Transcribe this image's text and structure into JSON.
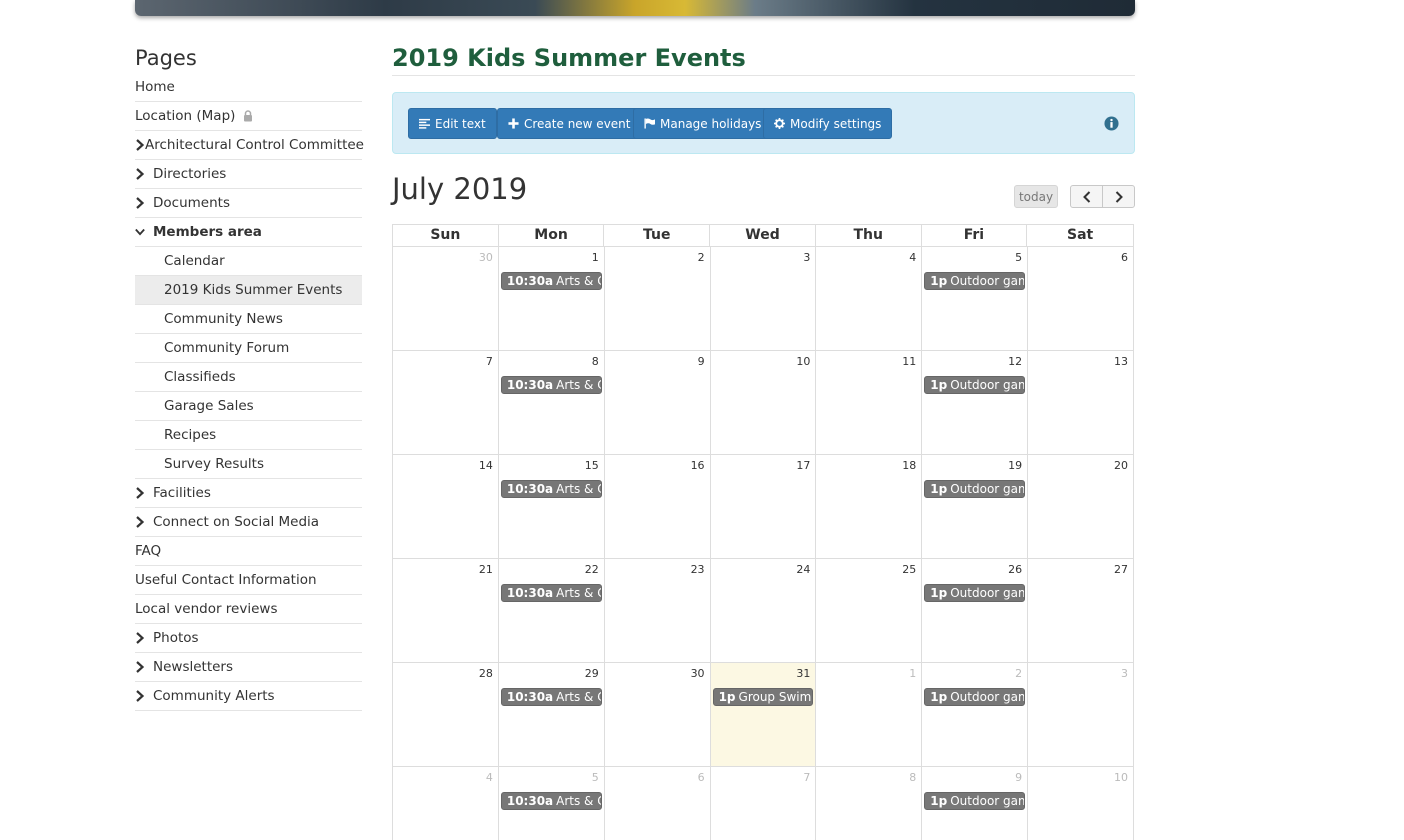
{
  "sidebar": {
    "title": "Pages",
    "items": [
      {
        "label": "Home",
        "type": "plain"
      },
      {
        "label": "Location (Map)",
        "type": "locked"
      },
      {
        "label": "Architectural Control Committee",
        "type": "collapsed"
      },
      {
        "label": "Directories",
        "type": "collapsed"
      },
      {
        "label": "Documents",
        "type": "collapsed"
      },
      {
        "label": "Members area",
        "type": "expanded"
      },
      {
        "label": "Calendar",
        "type": "sub"
      },
      {
        "label": "2019 Kids Summer Events",
        "type": "sub-active"
      },
      {
        "label": "Community News",
        "type": "sub"
      },
      {
        "label": "Community Forum",
        "type": "sub"
      },
      {
        "label": "Classifieds",
        "type": "sub"
      },
      {
        "label": "Garage Sales",
        "type": "sub"
      },
      {
        "label": "Recipes",
        "type": "sub"
      },
      {
        "label": "Survey Results",
        "type": "sub"
      },
      {
        "label": "Facilities",
        "type": "collapsed"
      },
      {
        "label": "Connect on Social Media",
        "type": "collapsed"
      },
      {
        "label": "FAQ",
        "type": "plain"
      },
      {
        "label": "Useful Contact Information",
        "type": "plain"
      },
      {
        "label": "Local vendor reviews",
        "type": "plain"
      },
      {
        "label": "Photos",
        "type": "collapsed"
      },
      {
        "label": "Newsletters",
        "type": "collapsed"
      },
      {
        "label": "Community Alerts",
        "type": "collapsed"
      }
    ]
  },
  "page": {
    "title": "2019 Kids Summer Events"
  },
  "toolbar": {
    "edit_text": "Edit text",
    "create_event": "Create new event",
    "manage_holidays": "Manage holidays",
    "modify_settings": "Modify settings"
  },
  "calendar": {
    "month_title": "July 2019",
    "today_label": "today",
    "weekdays": [
      "Sun",
      "Mon",
      "Tue",
      "Wed",
      "Thu",
      "Fri",
      "Sat"
    ],
    "weeks": [
      [
        {
          "n": "30",
          "o": true
        },
        {
          "n": "1",
          "e": {
            "t": "10:30a",
            "x": "Arts & Crafts"
          }
        },
        {
          "n": "2"
        },
        {
          "n": "3"
        },
        {
          "n": "4"
        },
        {
          "n": "5",
          "e": {
            "t": "1p",
            "x": "Outdoor games"
          }
        },
        {
          "n": "6"
        }
      ],
      [
        {
          "n": "7"
        },
        {
          "n": "8",
          "e": {
            "t": "10:30a",
            "x": "Arts & Crafts"
          }
        },
        {
          "n": "9"
        },
        {
          "n": "10"
        },
        {
          "n": "11"
        },
        {
          "n": "12",
          "e": {
            "t": "1p",
            "x": "Outdoor games"
          }
        },
        {
          "n": "13"
        }
      ],
      [
        {
          "n": "14"
        },
        {
          "n": "15",
          "e": {
            "t": "10:30a",
            "x": "Arts & Crafts"
          }
        },
        {
          "n": "16"
        },
        {
          "n": "17"
        },
        {
          "n": "18"
        },
        {
          "n": "19",
          "e": {
            "t": "1p",
            "x": "Outdoor games"
          }
        },
        {
          "n": "20"
        }
      ],
      [
        {
          "n": "21"
        },
        {
          "n": "22",
          "e": {
            "t": "10:30a",
            "x": "Arts & Crafts"
          }
        },
        {
          "n": "23"
        },
        {
          "n": "24"
        },
        {
          "n": "25"
        },
        {
          "n": "26",
          "e": {
            "t": "1p",
            "x": "Outdoor games"
          }
        },
        {
          "n": "27"
        }
      ],
      [
        {
          "n": "28"
        },
        {
          "n": "29",
          "e": {
            "t": "10:30a",
            "x": "Arts & Crafts"
          }
        },
        {
          "n": "30"
        },
        {
          "n": "31",
          "today": true,
          "e": {
            "t": "1p",
            "x": "Group Swim"
          }
        },
        {
          "n": "1",
          "o": true
        },
        {
          "n": "2",
          "o": true,
          "e": {
            "t": "1p",
            "x": "Outdoor games"
          }
        },
        {
          "n": "3",
          "o": true
        }
      ],
      [
        {
          "n": "4",
          "o": true
        },
        {
          "n": "5",
          "o": true,
          "e": {
            "t": "10:30a",
            "x": "Arts & Crafts"
          }
        },
        {
          "n": "6",
          "o": true
        },
        {
          "n": "7",
          "o": true
        },
        {
          "n": "8",
          "o": true
        },
        {
          "n": "9",
          "o": true,
          "e": {
            "t": "1p",
            "x": "Outdoor games"
          }
        },
        {
          "n": "10",
          "o": true
        }
      ]
    ]
  }
}
